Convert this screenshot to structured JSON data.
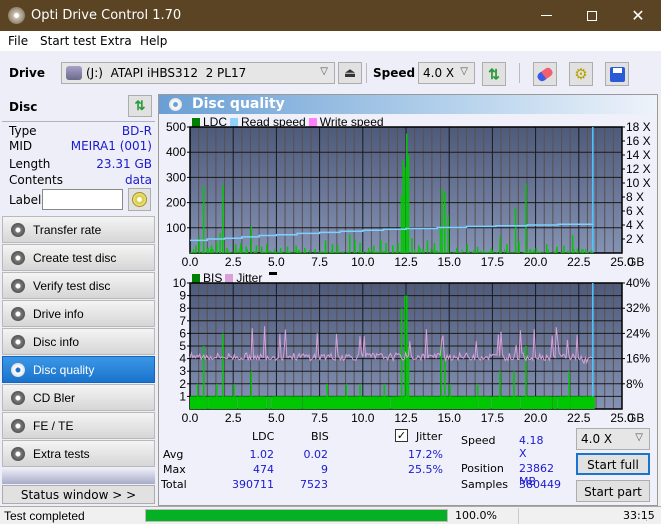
{
  "window": {
    "title": "Opti Drive Control 1.70",
    "minimize_icon": "minimize-icon",
    "maximize_icon": "maximize-icon",
    "close_icon": "close-icon"
  },
  "menu": [
    "File",
    "Start test",
    "Extra",
    "Help"
  ],
  "toolbar": {
    "drive_label": "Drive",
    "drive_value": "(J:)  ATAPI iHBS312  2 PL17",
    "speed_label": "Speed",
    "speed_value": "4.0 X",
    "icons": [
      "eject-icon",
      "refresh-icon",
      "eraser-icon",
      "settings-icon",
      "save-icon"
    ]
  },
  "disc": {
    "header": "Disc",
    "rows": [
      {
        "key": "Type",
        "value": "BD-R"
      },
      {
        "key": "MID",
        "value": "MEIRA1 (001)"
      },
      {
        "key": "Length",
        "value": "23.31 GB"
      },
      {
        "key": "Contents",
        "value": "data"
      }
    ],
    "label_key": "Label",
    "label_value": ""
  },
  "nav": [
    {
      "label": "Transfer rate",
      "active": false
    },
    {
      "label": "Create test disc",
      "active": false
    },
    {
      "label": "Verify test disc",
      "active": false
    },
    {
      "label": "Drive info",
      "active": false
    },
    {
      "label": "Disc info",
      "active": false
    },
    {
      "label": "Disc quality",
      "active": true
    },
    {
      "label": "CD Bler",
      "active": false
    },
    {
      "label": "FE / TE",
      "active": false
    },
    {
      "label": "Extra tests",
      "active": false
    }
  ],
  "status_window_label": "Status window > >",
  "panel": {
    "title": "Disc quality"
  },
  "colors": {
    "ldc": "#00c800",
    "bis": "#00c800",
    "read_speed": "#7fcfff",
    "write_speed": "#ff80ff",
    "jitter": "#d8a0d8",
    "plot_bg_top": "#4e5a7a",
    "plot_bg_bottom": "#8090b0",
    "accent": "#1a73cc"
  },
  "chart_data": [
    {
      "type": "bar",
      "title": "LDC / Read speed",
      "legend": [
        "LDC",
        "Read speed",
        "Write speed"
      ],
      "xlabel": "GB",
      "xlim": [
        0,
        25
      ],
      "xticks": [
        "0.0",
        "2.5",
        "5.0",
        "7.5",
        "10.0",
        "12.5",
        "15.0",
        "17.5",
        "20.0",
        "22.5",
        "25.0"
      ],
      "ylim": [
        0,
        500
      ],
      "yticks": [
        "100",
        "200",
        "300",
        "400",
        "500"
      ],
      "y2lim": [
        0,
        18
      ],
      "y2ticks": [
        "2 X",
        "4 X",
        "6 X",
        "8 X",
        "10 X",
        "12 X",
        "14 X",
        "16 X",
        "18 X"
      ],
      "data_end": 23.31,
      "ldc_peaks": [
        [
          0.3,
          30
        ],
        [
          0.5,
          65
        ],
        [
          0.75,
          265
        ],
        [
          1.0,
          20
        ],
        [
          1.2,
          30
        ],
        [
          1.5,
          45
        ],
        [
          1.7,
          80
        ],
        [
          1.85,
          270
        ],
        [
          2.1,
          20
        ],
        [
          2.6,
          35
        ],
        [
          2.9,
          40
        ],
        [
          3.2,
          25
        ],
        [
          3.5,
          105
        ],
        [
          3.8,
          30
        ],
        [
          4.1,
          25
        ],
        [
          4.4,
          35
        ],
        [
          5.2,
          20
        ],
        [
          5.6,
          25
        ],
        [
          6.1,
          30
        ],
        [
          6.6,
          20
        ],
        [
          7.2,
          15
        ],
        [
          7.8,
          50
        ],
        [
          8.2,
          35
        ],
        [
          8.5,
          30
        ],
        [
          9.2,
          75
        ],
        [
          9.5,
          55
        ],
        [
          9.8,
          40
        ],
        [
          10.3,
          20
        ],
        [
          10.6,
          30
        ],
        [
          11.0,
          50
        ],
        [
          11.3,
          40
        ],
        [
          11.7,
          30
        ],
        [
          12.0,
          40
        ],
        [
          12.2,
          230
        ],
        [
          12.3,
          370
        ],
        [
          12.4,
          340
        ],
        [
          12.5,
          474
        ],
        [
          12.6,
          390
        ],
        [
          12.8,
          60
        ],
        [
          13.2,
          30
        ],
        [
          13.7,
          50
        ],
        [
          14.1,
          40
        ],
        [
          14.45,
          105
        ],
        [
          14.55,
          255
        ],
        [
          14.7,
          240
        ],
        [
          14.9,
          150
        ],
        [
          15.4,
          20
        ],
        [
          16.0,
          35
        ],
        [
          16.6,
          25
        ],
        [
          17.4,
          20
        ],
        [
          17.9,
          65
        ],
        [
          18.3,
          35
        ],
        [
          18.8,
          180
        ],
        [
          19.0,
          45
        ],
        [
          19.4,
          275
        ],
        [
          20.0,
          20
        ],
        [
          20.6,
          35
        ],
        [
          21.2,
          25
        ],
        [
          21.6,
          30
        ],
        [
          22.1,
          70
        ],
        [
          22.7,
          15
        ],
        [
          23.2,
          10
        ]
      ],
      "read_speed_steps": [
        [
          0.0,
          1.8
        ],
        [
          1.0,
          2.0
        ],
        [
          2.0,
          2.1
        ],
        [
          3.0,
          2.3
        ],
        [
          4.0,
          2.5
        ],
        [
          5.0,
          2.6
        ],
        [
          6.2,
          2.8
        ],
        [
          7.5,
          2.95
        ],
        [
          8.7,
          3.1
        ],
        [
          10.0,
          3.25
        ],
        [
          11.2,
          3.4
        ],
        [
          12.5,
          3.5
        ],
        [
          14.3,
          3.65
        ],
        [
          16.0,
          3.8
        ],
        [
          17.7,
          3.9
        ],
        [
          19.5,
          4.0
        ],
        [
          21.3,
          4.1
        ],
        [
          23.31,
          4.18
        ]
      ]
    },
    {
      "type": "bar",
      "title": "BIS / Jitter",
      "legend": [
        "BIS",
        "Jitter"
      ],
      "xlabel": "GB",
      "xlim": [
        0,
        25
      ],
      "xticks": [
        "0.0",
        "2.5",
        "5.0",
        "7.5",
        "10.0",
        "12.5",
        "15.0",
        "17.5",
        "20.0",
        "22.5",
        "25.0"
      ],
      "ylim": [
        0,
        10
      ],
      "yticks": [
        "1",
        "2",
        "3",
        "4",
        "5",
        "6",
        "7",
        "8",
        "9",
        "10"
      ],
      "y2lim": [
        0,
        40
      ],
      "y2ticks": [
        "8%",
        "16%",
        "24%",
        "32%",
        "40%"
      ],
      "data_end": 23.31,
      "bis_baseline": 1,
      "bis_peaks": [
        [
          0.4,
          2
        ],
        [
          0.75,
          5
        ],
        [
          1.5,
          2
        ],
        [
          1.85,
          6
        ],
        [
          2.5,
          2
        ],
        [
          3.5,
          3
        ],
        [
          7.9,
          2
        ],
        [
          9.0,
          2
        ],
        [
          9.8,
          2
        ],
        [
          11.2,
          2
        ],
        [
          12.2,
          8
        ],
        [
          12.4,
          9
        ],
        [
          12.5,
          9
        ],
        [
          12.6,
          5
        ],
        [
          14.5,
          5
        ],
        [
          14.7,
          4
        ],
        [
          15.0,
          2
        ],
        [
          16.6,
          2
        ],
        [
          17.9,
          3
        ],
        [
          18.7,
          3
        ],
        [
          19.4,
          5
        ],
        [
          21.9,
          3
        ]
      ],
      "jitter_avg_percent": 17.2,
      "jitter_max_percent": 25.5
    }
  ],
  "stats": {
    "col_ldc": "LDC",
    "col_bis": "BIS",
    "jitter_label": "Jitter",
    "jitter_checked": true,
    "rows": [
      {
        "label": "Avg",
        "ldc": "1.02",
        "bis": "0.02",
        "jitter": "17.2%"
      },
      {
        "label": "Max",
        "ldc": "474",
        "bis": "9",
        "jitter": "25.5%"
      },
      {
        "label": "Total",
        "ldc": "390711",
        "bis": "7523",
        "jitter": ""
      }
    ],
    "speed_label": "Speed",
    "speed_value": "4.18 X",
    "position_label": "Position",
    "position_value": "23862 MB",
    "samples_label": "Samples",
    "samples_value": "380449",
    "speed_select": "4.0 X",
    "start_full": "Start full",
    "start_part": "Start part"
  },
  "statusbar": {
    "text": "Test completed",
    "progress_percent": 100.0,
    "progress_text": "100.0%",
    "time": "33:15"
  }
}
